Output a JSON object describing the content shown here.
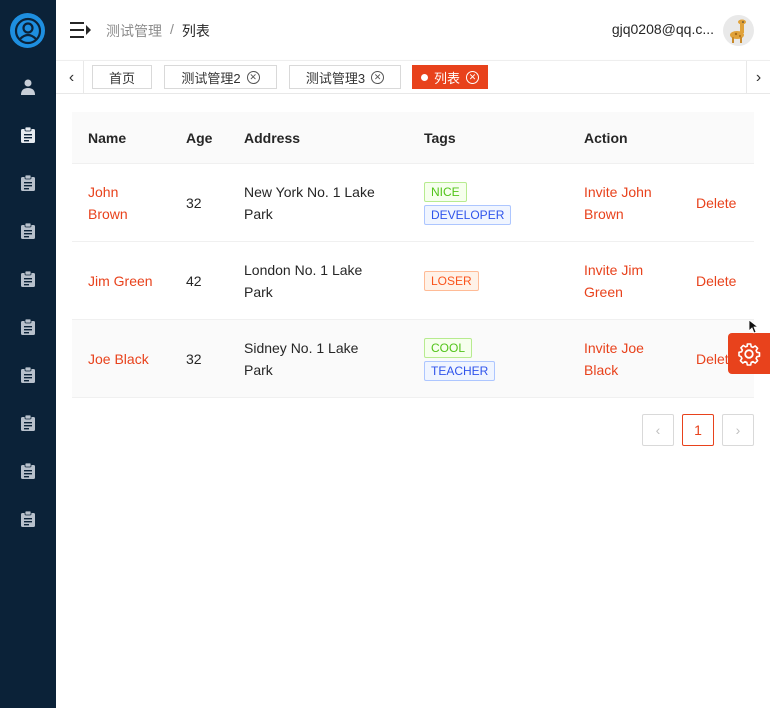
{
  "breadcrumb": {
    "parent": "测试管理",
    "separator": "/",
    "current": "列表"
  },
  "user": {
    "email": "gjq0208@qq.c..."
  },
  "tabs": [
    {
      "label": "首页"
    },
    {
      "label": "测试管理2"
    },
    {
      "label": "测试管理3"
    },
    {
      "label": "列表"
    }
  ],
  "table": {
    "headers": {
      "name": "Name",
      "age": "Age",
      "address": "Address",
      "tags": "Tags",
      "action": "Action"
    },
    "rows": [
      {
        "name": "John Brown",
        "age": "32",
        "address": "New York No. 1 Lake Park",
        "tags": [
          "NICE",
          "DEVELOPER"
        ],
        "invite": "Invite John Brown",
        "delete": "Delete"
      },
      {
        "name": "Jim Green",
        "age": "42",
        "address": "London No. 1 Lake Park",
        "tags": [
          "LOSER"
        ],
        "invite": "Invite Jim Green",
        "delete": "Delete"
      },
      {
        "name": "Joe Black",
        "age": "32",
        "address": "Sidney No. 1 Lake Park",
        "tags": [
          "COOL",
          "TEACHER"
        ],
        "invite": "Invite Joe Black",
        "delete": "Delete"
      }
    ]
  },
  "pagination": {
    "prev": "‹",
    "current": "1",
    "next": "›"
  },
  "colors": {
    "accent": "#e8421c",
    "sidebar": "#0b2238",
    "logo": "#1e8fe0"
  },
  "icons": {
    "logo": "user-circle-icon",
    "menu": "menu-fold-icon",
    "settings": "gear-icon"
  }
}
